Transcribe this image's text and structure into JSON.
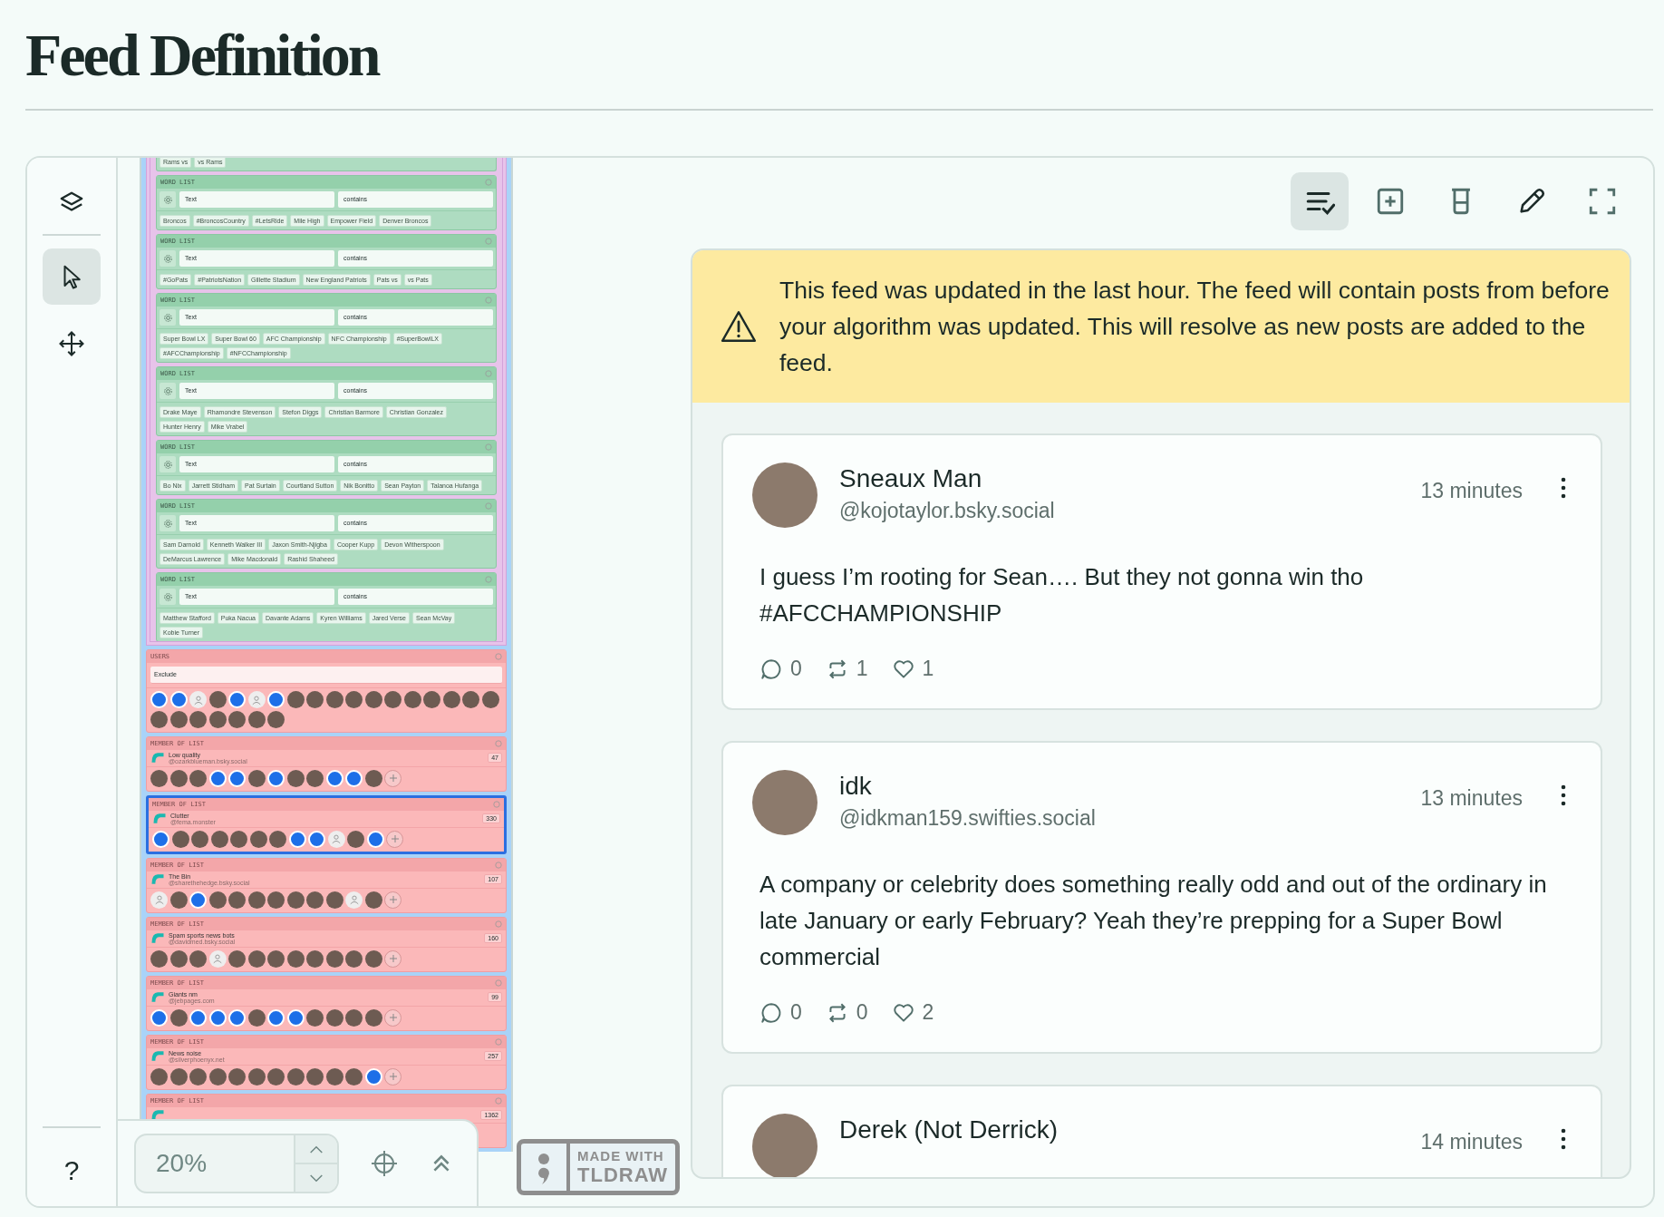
{
  "page": {
    "title": "Feed Definition"
  },
  "sidebar": {
    "tools": [
      {
        "kind": "layers",
        "selected": false
      },
      {
        "kind": "select",
        "selected": true
      },
      {
        "kind": "move",
        "selected": false
      }
    ],
    "help": "?"
  },
  "canvas": {
    "top_tags": [
      "Rams vs",
      "vs Rams"
    ],
    "word_lists": [
      {
        "header": "WORD LIST",
        "field": "Text",
        "operator": "contains",
        "tags": [
          "Broncos",
          "#BroncosCountry",
          "#LetsRide",
          "Mile High",
          "Empower Field",
          "Denver Broncos"
        ]
      },
      {
        "header": "WORD LIST",
        "field": "Text",
        "operator": "contains",
        "tags": [
          "#GoPats",
          "#PatriotsNation",
          "Gillette Stadium",
          "New England Patriots",
          "Pats vs",
          "vs Pats"
        ]
      },
      {
        "header": "WORD LIST",
        "field": "Text",
        "operator": "contains",
        "tags": [
          "Super Bowl LX",
          "Super Bowl 60",
          "AFC Championship",
          "NFC Championship",
          "#SuperBowlLX",
          "#AFCChampionship",
          "#NFCChampionship"
        ]
      },
      {
        "header": "WORD LIST",
        "field": "Text",
        "operator": "contains",
        "tags": [
          "Drake Maye",
          "Rhamondre Stevenson",
          "Stefon Diggs",
          "Christian Barmore",
          "Christian Gonzalez",
          "Hunter Henry",
          "Mike Vrabel"
        ]
      },
      {
        "header": "WORD LIST",
        "field": "Text",
        "operator": "contains",
        "tags": [
          "Bo Nix",
          "Jarrett Stidham",
          "Pat Surtain",
          "Courtland Sutton",
          "Nik Bonitto",
          "Sean Payton",
          "Talanoa Hufanga"
        ]
      },
      {
        "header": "WORD LIST",
        "field": "Text",
        "operator": "contains",
        "tags": [
          "Sam Darnold",
          "Kenneth Walker III",
          "Jaxon Smith-Njigba",
          "Cooper Kupp",
          "Devon Witherspoon",
          "DeMarcus Lawrence",
          "Mike Macdonald",
          "Rashid Shaheed"
        ]
      },
      {
        "header": "WORD LIST",
        "field": "Text",
        "operator": "contains",
        "tags": [
          "Matthew Stafford",
          "Puka Nacua",
          "Davante Adams",
          "Kyren Williams",
          "Jared Verse",
          "Sean McVay",
          "Kobie Turner"
        ]
      }
    ],
    "users": {
      "header": "USERS",
      "mode": "Exclude",
      "avatars": [
        {
          "kind": "logo"
        },
        {
          "kind": "logo"
        },
        {
          "kind": "blank"
        },
        {
          "kind": "photo"
        },
        {
          "kind": "logo"
        },
        {
          "kind": "blank"
        },
        {
          "kind": "logo"
        },
        {
          "kind": "photo"
        },
        {
          "kind": "photo"
        },
        {
          "kind": "photo"
        },
        {
          "kind": "photo"
        },
        {
          "kind": "photo"
        },
        {
          "kind": "photo"
        },
        {
          "kind": "photo"
        },
        {
          "kind": "photo"
        },
        {
          "kind": "photo"
        },
        {
          "kind": "photo"
        },
        {
          "kind": "photo"
        },
        {
          "kind": "photo"
        },
        {
          "kind": "photo"
        },
        {
          "kind": "photo"
        },
        {
          "kind": "photo"
        },
        {
          "kind": "photo"
        },
        {
          "kind": "photo"
        },
        {
          "kind": "photo"
        }
      ]
    },
    "member_lists": [
      {
        "header": "MEMBER OF LIST",
        "name": "Low quality",
        "handle": "@ozarkblueman.bsky.social",
        "count": "47",
        "selected": false,
        "avatars": [
          {
            "kind": "photo"
          },
          {
            "kind": "photo"
          },
          {
            "kind": "photo"
          },
          {
            "kind": "logo"
          },
          {
            "kind": "logo"
          },
          {
            "kind": "photo"
          },
          {
            "kind": "logo"
          },
          {
            "kind": "photo"
          },
          {
            "kind": "photo"
          },
          {
            "kind": "logo"
          },
          {
            "kind": "logo"
          },
          {
            "kind": "photo"
          }
        ]
      },
      {
        "header": "MEMBER OF LIST",
        "name": "Clutter",
        "handle": "@fema.monster",
        "count": "330",
        "selected": true,
        "avatars": [
          {
            "kind": "logo"
          },
          {
            "kind": "photo"
          },
          {
            "kind": "photo"
          },
          {
            "kind": "photo"
          },
          {
            "kind": "photo"
          },
          {
            "kind": "photo"
          },
          {
            "kind": "photo"
          },
          {
            "kind": "logo"
          },
          {
            "kind": "logo"
          },
          {
            "kind": "blank"
          },
          {
            "kind": "photo"
          },
          {
            "kind": "logo"
          }
        ]
      },
      {
        "header": "MEMBER OF LIST",
        "name": "The Bin",
        "handle": "@sharethehedge.bsky.social",
        "count": "107",
        "selected": false,
        "avatars": [
          {
            "kind": "blank"
          },
          {
            "kind": "photo"
          },
          {
            "kind": "logo"
          },
          {
            "kind": "photo"
          },
          {
            "kind": "photo"
          },
          {
            "kind": "photo"
          },
          {
            "kind": "photo"
          },
          {
            "kind": "photo"
          },
          {
            "kind": "photo"
          },
          {
            "kind": "photo"
          },
          {
            "kind": "blank"
          },
          {
            "kind": "photo"
          }
        ]
      },
      {
        "header": "MEMBER OF LIST",
        "name": "Spam sports news bots",
        "handle": "@davidmed.bsky.social",
        "count": "160",
        "selected": false,
        "avatars": [
          {
            "kind": "photo"
          },
          {
            "kind": "photo"
          },
          {
            "kind": "photo"
          },
          {
            "kind": "blank"
          },
          {
            "kind": "photo"
          },
          {
            "kind": "photo"
          },
          {
            "kind": "photo"
          },
          {
            "kind": "photo"
          },
          {
            "kind": "photo"
          },
          {
            "kind": "photo"
          },
          {
            "kind": "photo"
          },
          {
            "kind": "photo"
          }
        ]
      },
      {
        "header": "MEMBER OF LIST",
        "name": "Giants nm",
        "handle": "@jebpages.com",
        "count": "99",
        "selected": false,
        "avatars": [
          {
            "kind": "logo"
          },
          {
            "kind": "photo"
          },
          {
            "kind": "logo"
          },
          {
            "kind": "logo"
          },
          {
            "kind": "logo"
          },
          {
            "kind": "photo"
          },
          {
            "kind": "logo"
          },
          {
            "kind": "logo"
          },
          {
            "kind": "photo"
          },
          {
            "kind": "photo"
          },
          {
            "kind": "photo"
          },
          {
            "kind": "photo"
          }
        ]
      },
      {
        "header": "MEMBER OF LIST",
        "name": "News noise",
        "handle": "@silverphoenyx.net",
        "count": "257",
        "selected": false,
        "avatars": [
          {
            "kind": "photo"
          },
          {
            "kind": "photo"
          },
          {
            "kind": "photo"
          },
          {
            "kind": "photo"
          },
          {
            "kind": "photo"
          },
          {
            "kind": "photo"
          },
          {
            "kind": "photo"
          },
          {
            "kind": "photo"
          },
          {
            "kind": "photo"
          },
          {
            "kind": "photo"
          },
          {
            "kind": "photo"
          },
          {
            "kind": "logo"
          }
        ]
      },
      {
        "header": "MEMBER OF LIST",
        "count": "1362",
        "selected": false
      }
    ]
  },
  "zoom_control": {
    "value": "20%"
  },
  "badge": {
    "line_1": "MADE WITH",
    "line_2": "TLDRAW"
  },
  "preview": {
    "toolbar": [
      {
        "kind": "checklist",
        "selected": true
      },
      {
        "kind": "add",
        "selected": false
      },
      {
        "kind": "beaker",
        "selected": false
      },
      {
        "kind": "edit",
        "selected": false
      },
      {
        "kind": "fullscreen",
        "selected": false
      }
    ],
    "notice": "This feed was updated in the last hour. The feed will contain posts from before your algorithm was updated. This will resolve as new posts are added to the feed.",
    "posts": [
      {
        "name": "Sneaux Man",
        "handle": "@kojotaylor.bsky.social",
        "time": "13 minutes",
        "text": "I guess I’m rooting for Sean…. But they not gonna win tho #AFCCHAMPIONSHIP",
        "replies": "0",
        "reposts": "1",
        "likes": "1"
      },
      {
        "name": "idk",
        "handle": "@idkman159.swifties.social",
        "time": "13 minutes",
        "text": "A company or celebrity does something really odd and out of the ordinary in late January or early February? Yeah they’re prepping for a Super Bowl commercial",
        "replies": "0",
        "reposts": "0",
        "likes": "2"
      },
      {
        "name": "Derek (Not Derrick)",
        "time": "14 minutes"
      }
    ]
  }
}
